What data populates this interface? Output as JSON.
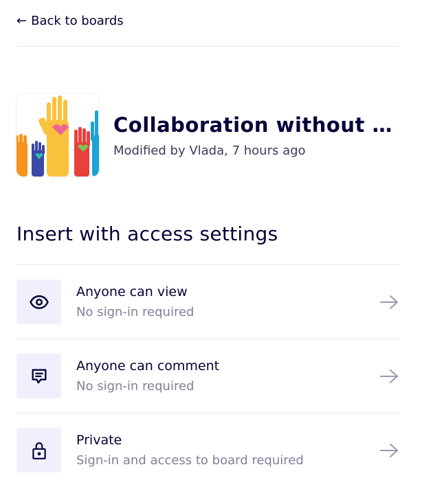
{
  "back": {
    "label": "Back to boards"
  },
  "board": {
    "title": "Collaboration without co...",
    "modified": "Modified by Vlada, 7 hours ago"
  },
  "section": {
    "heading": "Insert with access settings"
  },
  "options": [
    {
      "title": "Anyone can view",
      "subtitle": "No sign-in required",
      "icon": "eye-icon"
    },
    {
      "title": "Anyone can comment",
      "subtitle": "No sign-in required",
      "icon": "comment-icon"
    },
    {
      "title": "Private",
      "subtitle": "Sign-in and access to board required",
      "icon": "lock-icon"
    }
  ],
  "colors": {
    "text_primary": "#050038",
    "text_secondary": "#827f9a",
    "icon_bg": "#eff0fc",
    "divider": "#e6e6ea"
  }
}
